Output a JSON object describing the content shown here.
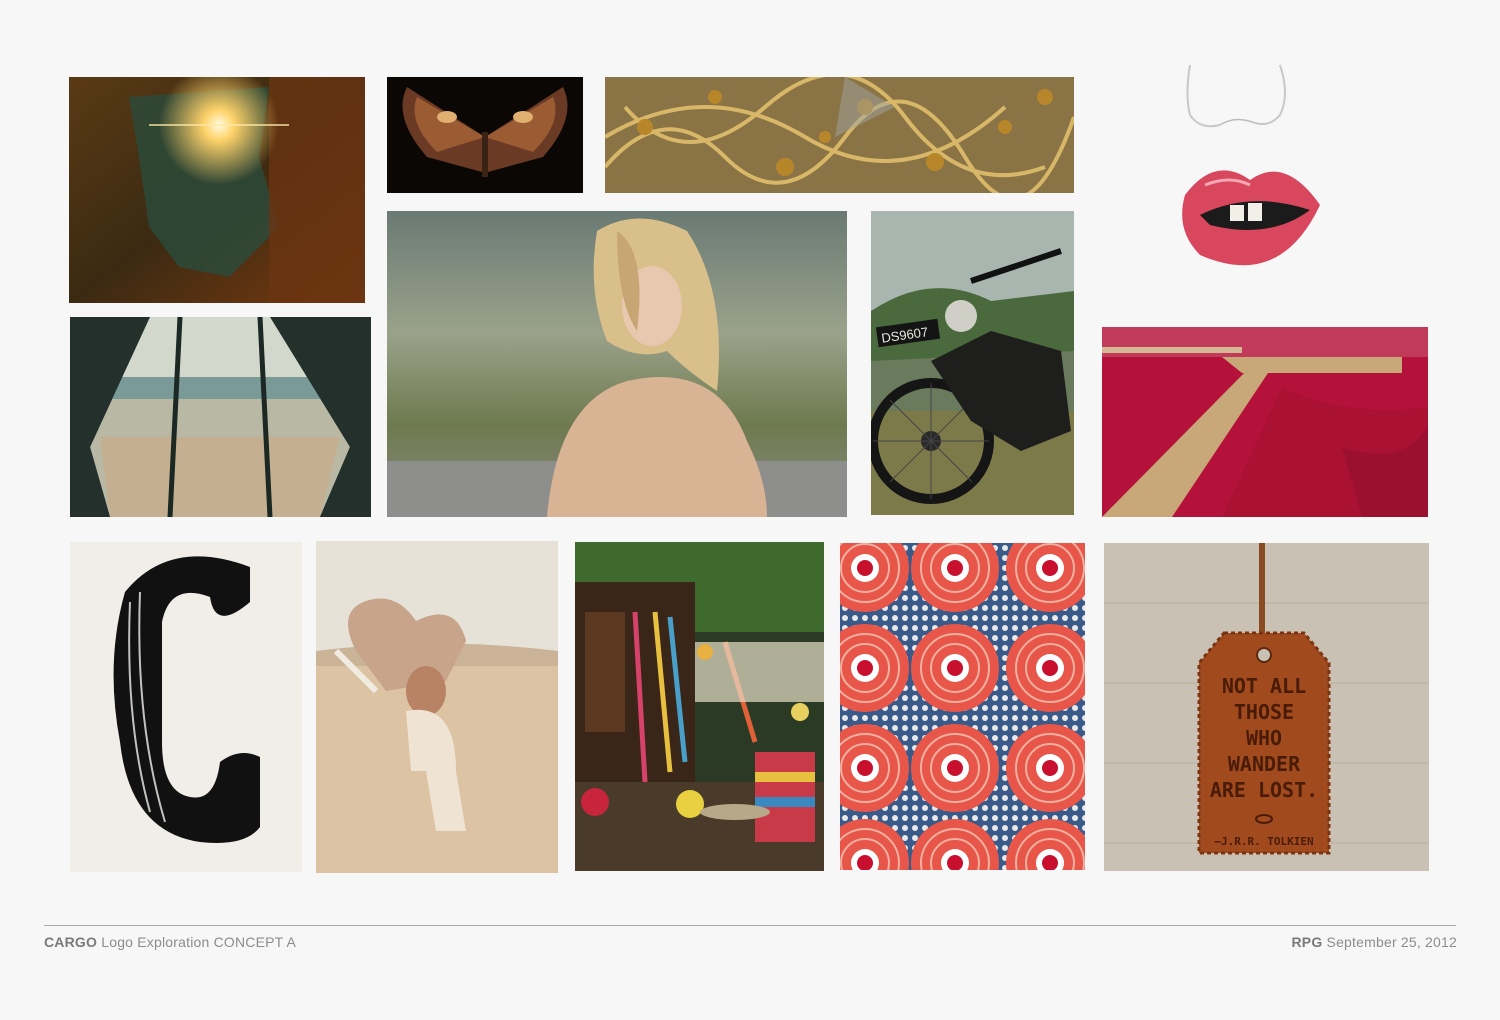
{
  "moodboard": {
    "tiles": [
      {
        "name": "sun-flare-photo"
      },
      {
        "name": "moth-photo"
      },
      {
        "name": "gold-embroidery-photo"
      },
      {
        "name": "lips-illustration"
      },
      {
        "name": "tent-beach-photo"
      },
      {
        "name": "fur-coat-model-photo"
      },
      {
        "name": "vintage-motorcycle-photo"
      },
      {
        "name": "red-beach-boardwalk-photo"
      },
      {
        "name": "brush-letter-c-image"
      },
      {
        "name": "headdress-desert-photo"
      },
      {
        "name": "garden-caravan-photo"
      },
      {
        "name": "red-circle-pattern-image"
      },
      {
        "name": "leather-luggage-tag-photo"
      }
    ],
    "motorcycle_plate": "DS9607",
    "tag_quote": [
      "NOT ALL",
      "THOSE",
      "WHO",
      "WANDER",
      "ARE LOST."
    ],
    "tag_author": "—J.R.R. TOLKIEN"
  },
  "footer": {
    "brand": "CARGO",
    "project": "Logo Exploration CONCEPT A",
    "agency": "RPG",
    "date": "September 25, 2012"
  },
  "colors": {
    "background": "#f7f7f7",
    "footer_text": "#8c8c8c",
    "rule": "#a9a9a9"
  }
}
